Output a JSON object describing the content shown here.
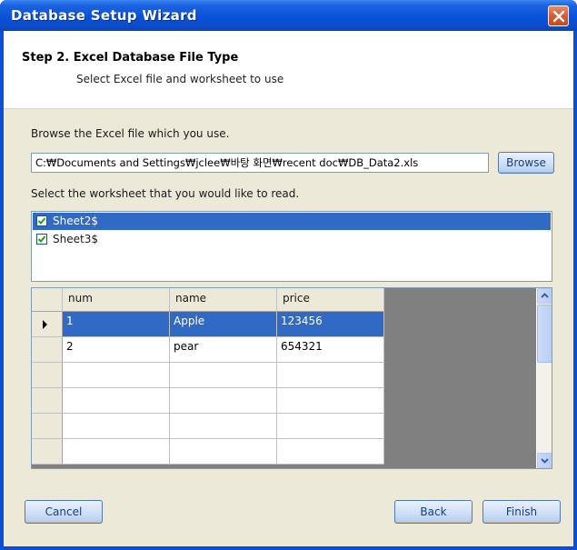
{
  "window": {
    "title": "Database Setup Wizard"
  },
  "header": {
    "step_title": "Step 2. Excel Database File Type",
    "step_subtitle": "Select Excel file and worksheet to use"
  },
  "file": {
    "prompt": "Browse the Excel file which you use.",
    "path": "C:₩Documents and Settings₩jclee₩바탕 화면₩recent doc₩DB_Data2.xls",
    "browse_label": "Browse"
  },
  "worksheets": {
    "prompt": "Select the worksheet that you would like to read.",
    "items": [
      {
        "label": "Sheet2$",
        "checked": true,
        "selected": true
      },
      {
        "label": "Sheet3$",
        "checked": true,
        "selected": false
      }
    ]
  },
  "grid": {
    "columns": [
      "num",
      "name",
      "price"
    ],
    "rows": [
      [
        "1",
        "Apple",
        "123456"
      ],
      [
        "2",
        "pear",
        "654321"
      ]
    ],
    "current_row_indicator": "▶"
  },
  "footer": {
    "cancel_label": "Cancel",
    "back_label": "Back",
    "finish_label": "Finish"
  },
  "colors": {
    "title_bar": "#0a52d8",
    "selection": "#316ac5",
    "dialog_bg": "#ece9d8"
  },
  "icons": {
    "close": "close-icon",
    "checkbox": "checkmark-icon",
    "scroll_up": "chevron-up-icon",
    "scroll_down": "chevron-down-icon",
    "row_pointer": "row-pointer-icon"
  }
}
